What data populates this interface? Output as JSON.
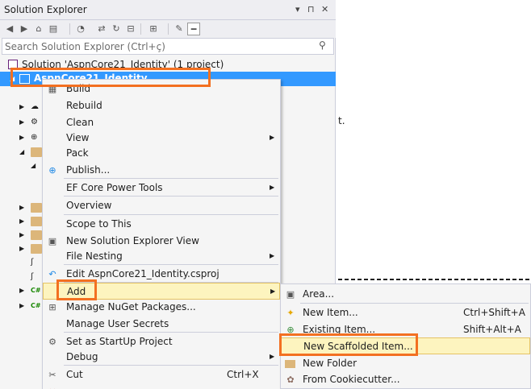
{
  "panel": {
    "title": "Solution Explorer",
    "controls": {
      "dropdown": "▾",
      "pin": "⊓",
      "close": "✕"
    }
  },
  "toolbar": {
    "icons": [
      "back-icon",
      "forward-icon",
      "home-icon",
      "switch-views-icon",
      "pending-changes-icon",
      "sync-icon",
      "refresh-icon",
      "collapse-all-icon",
      "properties-icon",
      "preview-icon"
    ]
  },
  "search": {
    "placeholder": "Search Solution Explorer (Ctrl+ç)",
    "icon": "search-icon"
  },
  "tree": {
    "solution_label": "Solution 'AspnCore21_Identity' (1 project)",
    "project_label": "AspnCore21_Identity"
  },
  "context_menu": {
    "items": [
      {
        "label": "Build",
        "icon": "build-icon"
      },
      {
        "label": "Rebuild"
      },
      {
        "label": "Clean"
      },
      {
        "label": "View",
        "submenu": true
      },
      {
        "label": "Pack"
      },
      {
        "label": "Publish...",
        "icon": "publish-icon"
      },
      {
        "label": "EF Core Power Tools",
        "submenu": true
      },
      {
        "label": "Overview"
      },
      {
        "label": "Scope to This"
      },
      {
        "label": "New Solution Explorer View",
        "icon": "new-view-icon"
      },
      {
        "label": "File Nesting",
        "submenu": true
      },
      {
        "label": "Edit AspnCore21_Identity.csproj",
        "icon": "edit-icon"
      },
      {
        "label": "Add",
        "submenu": true
      },
      {
        "label": "Manage NuGet Packages...",
        "icon": "nuget-icon"
      },
      {
        "label": "Manage User Secrets"
      },
      {
        "label": "Set as StartUp Project",
        "icon": "gear-icon"
      },
      {
        "label": "Debug",
        "submenu": true
      },
      {
        "label": "Cut",
        "icon": "cut-icon",
        "shortcut": "Ctrl+X"
      }
    ]
  },
  "add_submenu": {
    "items": [
      {
        "label": "Area...",
        "icon": "area-icon"
      },
      {
        "label": "New Item...",
        "icon": "new-item-icon",
        "shortcut": "Ctrl+Shift+A"
      },
      {
        "label": "Existing Item...",
        "icon": "existing-item-icon",
        "shortcut": "Shift+Alt+A"
      },
      {
        "label": "New Scaffolded Item..."
      },
      {
        "label": "New Folder",
        "icon": "folder-icon"
      },
      {
        "label": "From Cookiecutter...",
        "icon": "cookiecutter-icon"
      }
    ]
  },
  "editor": {
    "fragment": "t."
  },
  "colors": {
    "selection": "#3399ff",
    "highlight_box": "#f37021",
    "menu_hover": "#fdf4bf"
  }
}
